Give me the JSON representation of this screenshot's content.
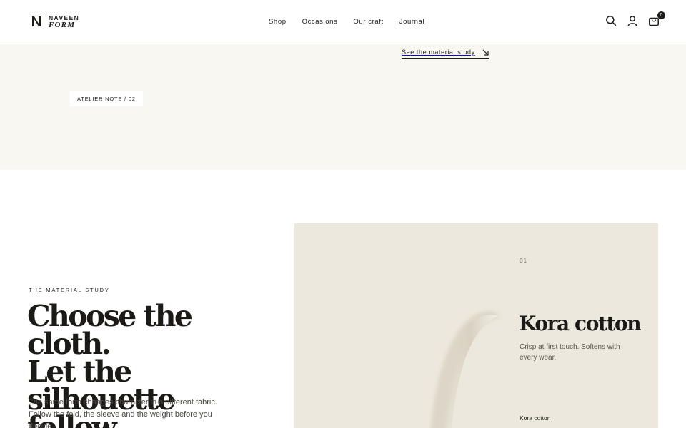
{
  "brand": {
    "line1": "NAVEEN",
    "line2": "FORM"
  },
  "nav": {
    "items": [
      "Shop",
      "Occasions",
      "Our craft",
      "Journal"
    ]
  },
  "header_icons": {
    "search": "search-icon",
    "account": "user-icon",
    "cart": "bag-icon",
    "cart_count": "0"
  },
  "atelier": {
    "link_label": "See the material study",
    "link_icon": "arrow-down-right-icon",
    "tag": "ATELIER NOTE / 02"
  },
  "material_study": {
    "eyebrow": "THE MATERIAL STUDY",
    "headline_lines": [
      "Choose the cloth.",
      "Let the silhouette",
      "follow."
    ],
    "body": "The same form changes character in a different fabric. Follow the fold, the sleeve and the weight before you decide.",
    "card": {
      "index": "01",
      "title": "Kora cotton",
      "description": "Crisp at first touch. Softens with every wear.",
      "swatch_label": "Kora cotton"
    }
  },
  "colors": {
    "band": "#f9f7f1",
    "card": "#ede8dd",
    "ink": "#1f1d1a"
  }
}
